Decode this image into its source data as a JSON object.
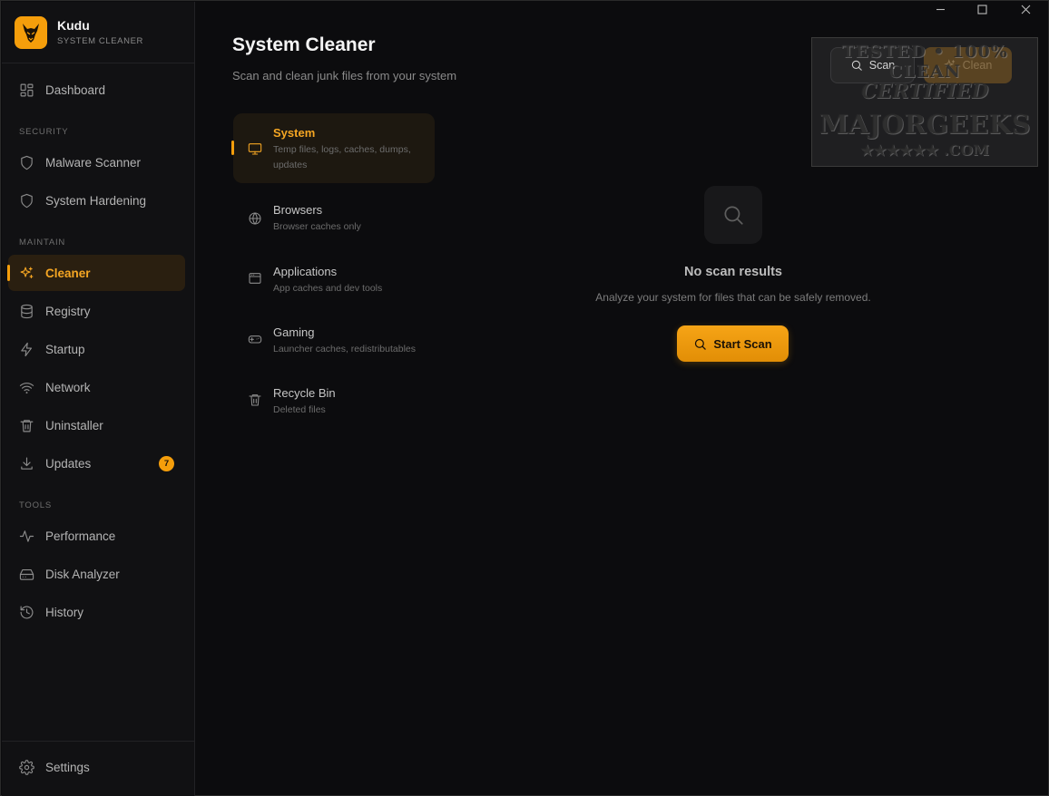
{
  "app": {
    "name": "Kudu",
    "subtitle": "SYSTEM CLEANER"
  },
  "sidebar": {
    "dashboard": "Dashboard",
    "sections": {
      "security": "SECURITY",
      "maintain": "MAINTAIN",
      "tools": "TOOLS"
    },
    "security_items": [
      "Malware Scanner",
      "System Hardening"
    ],
    "maintain_items": [
      "Cleaner",
      "Registry",
      "Startup",
      "Network",
      "Uninstaller",
      "Updates"
    ],
    "tools_items": [
      "Performance",
      "Disk Analyzer",
      "History"
    ],
    "updates_badge": "7",
    "settings": "Settings",
    "active_item": "Cleaner"
  },
  "header": {
    "title": "System Cleaner",
    "subtitle": "Scan and clean junk files from your system",
    "scan_label": "Scan",
    "clean_label": "Clean"
  },
  "watermark": {
    "line1": "TESTED • 100% CLEAN",
    "line2": "CERTIFIED",
    "line3": "MAJORGEEKS",
    "line4": "★★★★★★ .COM"
  },
  "categories": [
    {
      "title": "System",
      "desc": "Temp files, logs, caches, dumps, updates"
    },
    {
      "title": "Browsers",
      "desc": "Browser caches only"
    },
    {
      "title": "Applications",
      "desc": "App caches and dev tools"
    },
    {
      "title": "Gaming",
      "desc": "Launcher caches, redistributables"
    },
    {
      "title": "Recycle Bin",
      "desc": "Deleted files"
    }
  ],
  "empty_state": {
    "title": "No scan results",
    "subtitle": "Analyze your system for files that can be safely removed.",
    "button": "Start Scan"
  },
  "colors": {
    "accent": "#f59e0b",
    "background": "#0c0c0e",
    "sidebar": "#111113"
  }
}
